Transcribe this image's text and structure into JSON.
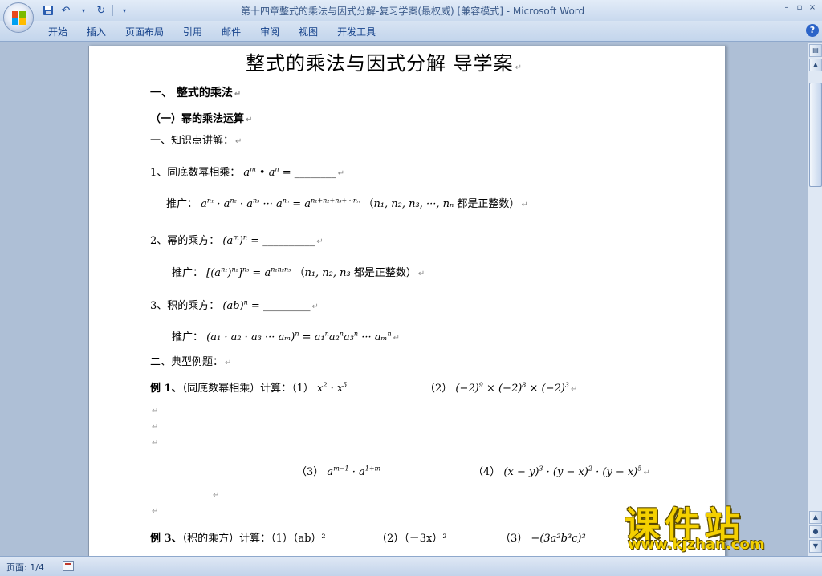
{
  "window": {
    "title": "第十四章整式的乘法与因式分解-复习学案(最权威) [兼容模式]",
    "app_name": "Microsoft Word",
    "controls": [
      "–",
      "▫",
      "×"
    ]
  },
  "ribbon": {
    "tabs": [
      "开始",
      "插入",
      "页面布局",
      "引用",
      "邮件",
      "审阅",
      "视图",
      "开发工具"
    ],
    "help_label": "?"
  },
  "document": {
    "title": "整式的乘法与因式分解  导学案",
    "section1": "一、   整式的乘法",
    "sub1": "（一）幂的乘法运算",
    "part1_label": "一、知识点讲解：",
    "rule1_text": "1、同底数幂相乘：",
    "rule1_math": "a^m • a^n = ________",
    "rule1_ext_label": "推广：",
    "rule1_ext_math": "a^n1 · a^n2 · a^n3 ··· a^nn = a^(n1+n2+n3+···nn)",
    "rule1_ext_note": "（n1, n2, n3, ···, nn 都是正整数）",
    "rule2_text": "2、幂的乘方：",
    "rule2_math": "(a^m)^n = __________",
    "rule2_ext_label": "推广：",
    "rule2_ext_math": "[(a^n1)^n2]^n3 = a^(n1n2n3)",
    "rule2_ext_note": "（n1, n2, n3 都是正整数）",
    "rule3_text": "3、积的乘方：",
    "rule3_math": "(ab)^n = _________",
    "rule3_ext_label": "推广：",
    "rule3_ext_math": "(a1 · a2 · a3 ··· am)^n = a1^n a2^n a3^n ··· am^n",
    "part2_label": "二、典型例题：",
    "ex1_label": "例 1、",
    "ex1_text": "（同底数幂相乘）计算：（1）",
    "ex1_math1": "x² · x⁵",
    "ex1_part2": "（2）",
    "ex1_math2": "(−2)⁹ × (−2)⁸ × (−2)³",
    "ex1_part3": "（3）",
    "ex1_math3": "a^(m−1) · a^(1+m)",
    "ex1_part4": "（4）",
    "ex1_math4": "(x − y)³ · (y − x)² · (y − x)⁵",
    "ex3_label": "例 3、",
    "ex3_text": "（积的乘方）计算：（1）（ab）²",
    "ex3_part2": "（2）（－3x）²",
    "ex3_part3": "（3）",
    "ex3_math3": "−(3a²b³c)³",
    "para_mark": "↵"
  },
  "status": {
    "page": "页面: 1/4"
  },
  "watermark": {
    "text": "课件站",
    "url": "www.kjzhan.com"
  }
}
